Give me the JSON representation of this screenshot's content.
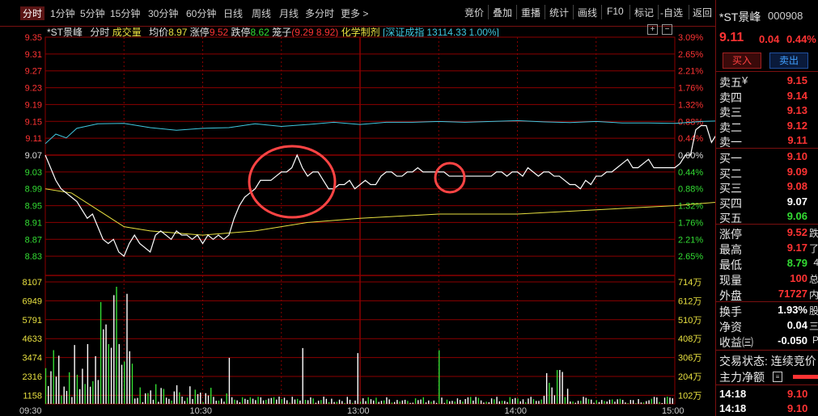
{
  "tabs": [
    "分时",
    "1分钟",
    "5分钟",
    "15分钟",
    "30分钟",
    "60分钟",
    "日线",
    "周线",
    "月线",
    "多分时",
    "更多 >"
  ],
  "right_buttons": [
    "竞价",
    "叠加",
    "重播",
    "统计",
    "画线",
    "F10",
    "标记",
    "-自选",
    "返回"
  ],
  "info": {
    "name": "*ST景峰",
    "period": "分时",
    "volume_label": "成交量",
    "avg_label": "均价",
    "avg": "8.97",
    "limit_up_label": "涨停",
    "limit_up": "9.52",
    "limit_down_label": "跌停",
    "limit_down": "8.62",
    "cage_label": "笼子",
    "cage": "(9.29 8.92)",
    "sector": "化学制剂",
    "index_name": "[深证成指",
    "index_val": "13114.33",
    "index_pct": "1.00%]"
  },
  "colors": {
    "price": "#ffffff",
    "avg": "#e8e040",
    "index": "#40c8e0",
    "up": "#ff3333",
    "down": "#33dd33",
    "grid": "#8b0000",
    "annotation": "#ff4444"
  },
  "chart_data": {
    "type": "line",
    "title": "",
    "price_axis": [
      "9.35",
      "9.31",
      "9.27",
      "9.23",
      "9.19",
      "9.15",
      "9.11",
      "9.07",
      "9.03",
      "8.99",
      "8.95",
      "8.91",
      "8.87",
      "8.83"
    ],
    "pct_axis": [
      "3.09%",
      "2.65%",
      "2.21%",
      "1.76%",
      "1.32%",
      "0.88%",
      "0.44%",
      "0.00%",
      "0.44%",
      "0.88%",
      "1.32%",
      "1.76%",
      "2.21%",
      "2.65%"
    ],
    "volume_axis_left": [
      "8107",
      "6949",
      "5791",
      "4633",
      "3474",
      "2316",
      "1158"
    ],
    "volume_axis_right": [
      "714万",
      "612万",
      "510万",
      "408万",
      "306万",
      "204万",
      "102万"
    ],
    "time_labels": [
      "09:30",
      "10:30",
      "13:00",
      "14:00",
      "15:00"
    ],
    "ylim": [
      8.79,
      9.35
    ],
    "prev_close": 9.07,
    "price": [
      [
        0,
        9.07
      ],
      [
        2,
        9.04
      ],
      [
        4,
        9.01
      ],
      [
        6,
        8.99
      ],
      [
        8,
        8.98
      ],
      [
        10,
        8.97
      ],
      [
        12,
        8.96
      ],
      [
        14,
        8.94
      ],
      [
        16,
        8.92
      ],
      [
        18,
        8.93
      ],
      [
        20,
        8.9
      ],
      [
        22,
        8.87
      ],
      [
        24,
        8.86
      ],
      [
        26,
        8.87
      ],
      [
        28,
        8.84
      ],
      [
        30,
        8.83
      ],
      [
        32,
        8.86
      ],
      [
        34,
        8.88
      ],
      [
        36,
        8.86
      ],
      [
        38,
        8.85
      ],
      [
        40,
        8.84
      ],
      [
        42,
        8.88
      ],
      [
        44,
        8.89
      ],
      [
        46,
        8.88
      ],
      [
        48,
        8.87
      ],
      [
        50,
        8.89
      ],
      [
        52,
        8.88
      ],
      [
        54,
        8.88
      ],
      [
        56,
        8.87
      ],
      [
        58,
        8.88
      ],
      [
        60,
        8.86
      ],
      [
        62,
        8.88
      ],
      [
        64,
        8.87
      ],
      [
        66,
        8.88
      ],
      [
        68,
        8.87
      ],
      [
        70,
        8.88
      ],
      [
        72,
        8.92
      ],
      [
        74,
        8.95
      ],
      [
        76,
        8.97
      ],
      [
        78,
        8.98
      ],
      [
        80,
        8.99
      ],
      [
        82,
        9.01
      ],
      [
        84,
        9.01
      ],
      [
        86,
        9.01
      ],
      [
        88,
        9.02
      ],
      [
        90,
        9.03
      ],
      [
        92,
        9.03
      ],
      [
        94,
        9.04
      ],
      [
        96,
        9.07
      ],
      [
        98,
        9.04
      ],
      [
        100,
        9.02
      ],
      [
        102,
        9.03
      ],
      [
        104,
        9.03
      ],
      [
        106,
        9.01
      ],
      [
        108,
        8.99
      ],
      [
        110,
        8.99
      ],
      [
        112,
        9.0
      ],
      [
        114,
        9.0
      ],
      [
        116,
        9.01
      ],
      [
        118,
        8.99
      ],
      [
        120,
        9.0
      ],
      [
        122,
        9.01
      ],
      [
        124,
        9.0
      ],
      [
        126,
        9.0
      ],
      [
        128,
        9.02
      ],
      [
        130,
        9.03
      ],
      [
        132,
        9.03
      ],
      [
        134,
        9.02
      ],
      [
        136,
        9.02
      ],
      [
        138,
        9.03
      ],
      [
        140,
        9.03
      ],
      [
        142,
        9.04
      ],
      [
        144,
        9.03
      ],
      [
        146,
        9.03
      ],
      [
        148,
        9.03
      ],
      [
        150,
        9.03
      ],
      [
        152,
        9.03
      ],
      [
        154,
        9.02
      ],
      [
        156,
        9.02
      ],
      [
        158,
        9.02
      ],
      [
        160,
        9.02
      ],
      [
        162,
        9.02
      ],
      [
        164,
        9.02
      ],
      [
        166,
        9.02
      ],
      [
        168,
        9.02
      ],
      [
        170,
        9.02
      ],
      [
        172,
        9.03
      ],
      [
        174,
        9.03
      ],
      [
        176,
        9.02
      ],
      [
        178,
        9.03
      ],
      [
        180,
        9.03
      ],
      [
        182,
        9.02
      ],
      [
        184,
        9.04
      ],
      [
        186,
        9.03
      ],
      [
        188,
        9.02
      ],
      [
        190,
        9.03
      ],
      [
        192,
        9.03
      ],
      [
        194,
        9.02
      ],
      [
        196,
        9.02
      ],
      [
        198,
        9.01
      ],
      [
        200,
        9.0
      ],
      [
        202,
        9.0
      ],
      [
        204,
        8.99
      ],
      [
        206,
        9.01
      ],
      [
        208,
        9.0
      ],
      [
        210,
        9.02
      ],
      [
        212,
        9.02
      ],
      [
        214,
        9.03
      ],
      [
        216,
        9.03
      ],
      [
        218,
        9.04
      ],
      [
        220,
        9.05
      ],
      [
        222,
        9.06
      ],
      [
        224,
        9.04
      ],
      [
        226,
        9.04
      ],
      [
        228,
        9.05
      ],
      [
        230,
        9.06
      ],
      [
        232,
        9.04
      ],
      [
        234,
        9.04
      ],
      [
        236,
        9.04
      ],
      [
        238,
        9.04
      ],
      [
        240,
        9.04
      ],
      [
        242,
        9.05
      ],
      [
        244,
        9.07
      ],
      [
        246,
        9.07
      ],
      [
        248,
        9.13
      ],
      [
        250,
        9.14
      ],
      [
        252,
        9.14
      ],
      [
        254,
        9.1
      ],
      [
        256,
        9.12
      ],
      [
        258,
        9.14
      ],
      [
        260,
        9.15
      ],
      [
        262,
        9.15
      ],
      [
        264,
        9.15
      ],
      [
        266,
        9.16
      ],
      [
        268,
        9.16
      ],
      [
        270,
        9.15
      ],
      [
        272,
        9.13
      ],
      [
        274,
        9.13
      ],
      [
        276,
        9.11
      ],
      [
        278,
        9.1
      ],
      [
        280,
        9.1
      ],
      [
        282,
        9.1
      ],
      [
        284,
        9.1
      ],
      [
        286,
        9.09
      ],
      [
        288,
        9.09
      ],
      [
        290,
        9.1
      ],
      [
        292,
        9.1
      ],
      [
        294,
        9.1
      ],
      [
        296,
        9.11
      ],
      [
        298,
        9.11
      ]
    ],
    "avg": [
      [
        0,
        8.99
      ],
      [
        10,
        8.98
      ],
      [
        20,
        8.94
      ],
      [
        30,
        8.9
      ],
      [
        40,
        8.89
      ],
      [
        60,
        8.88
      ],
      [
        80,
        8.89
      ],
      [
        100,
        8.91
      ],
      [
        120,
        8.92
      ],
      [
        150,
        8.93
      ],
      [
        180,
        8.93
      ],
      [
        210,
        8.94
      ],
      [
        240,
        8.95
      ],
      [
        260,
        8.96
      ],
      [
        280,
        8.97
      ],
      [
        298,
        8.97
      ]
    ],
    "index_pct": [
      [
        0,
        0.3
      ],
      [
        4,
        0.55
      ],
      [
        8,
        0.45
      ],
      [
        12,
        0.7
      ],
      [
        20,
        0.82
      ],
      [
        30,
        0.83
      ],
      [
        40,
        0.72
      ],
      [
        50,
        0.65
      ],
      [
        60,
        0.7
      ],
      [
        70,
        0.72
      ],
      [
        80,
        0.82
      ],
      [
        90,
        0.75
      ],
      [
        100,
        0.8
      ],
      [
        110,
        0.86
      ],
      [
        120,
        0.8
      ],
      [
        130,
        0.86
      ],
      [
        140,
        0.86
      ],
      [
        150,
        0.88
      ],
      [
        160,
        0.86
      ],
      [
        170,
        0.88
      ],
      [
        180,
        0.9
      ],
      [
        190,
        0.87
      ],
      [
        200,
        0.85
      ],
      [
        210,
        0.88
      ],
      [
        220,
        0.84
      ],
      [
        230,
        0.84
      ],
      [
        240,
        0.83
      ],
      [
        250,
        0.88
      ],
      [
        260,
        0.9
      ],
      [
        270,
        0.92
      ],
      [
        280,
        0.94
      ],
      [
        290,
        0.95
      ],
      [
        298,
        0.93
      ]
    ]
  },
  "panel": {
    "name": "*ST景峰",
    "code": "000908",
    "price": "9.11",
    "change": "0.04",
    "change_pct": "0.44%",
    "buy_btn": "买入",
    "sell_btn": "卖出",
    "asks": [
      {
        "label": "卖五",
        "price": "9.15"
      },
      {
        "label": "卖四",
        "price": "9.14"
      },
      {
        "label": "卖三",
        "price": "9.13"
      },
      {
        "label": "卖二",
        "price": "9.12"
      },
      {
        "label": "卖一",
        "price": "9.11"
      }
    ],
    "ask_suffix": "¥",
    "bids": [
      {
        "label": "买一",
        "price": "9.10"
      },
      {
        "label": "买二",
        "price": "9.09"
      },
      {
        "label": "买三",
        "price": "9.08"
      },
      {
        "label": "买四",
        "price": "9.07"
      },
      {
        "label": "买五",
        "price": "9.06"
      }
    ],
    "stats": [
      {
        "label": "涨停",
        "value": "9.52",
        "extra": "跌"
      },
      {
        "label": "最高",
        "value": "9.17",
        "extra": "了"
      },
      {
        "label": "最低",
        "value": "8.79",
        "extra": "4"
      },
      {
        "label": "现量",
        "value": "100",
        "extra": "总"
      },
      {
        "label": "外盘",
        "value": "71727",
        "extra": "内"
      }
    ],
    "stats2": [
      {
        "label": "换手",
        "value": "1.93%",
        "extra": "股"
      },
      {
        "label": "净资",
        "value": "0.04",
        "extra": "三"
      },
      {
        "label": "收益㈢",
        "value": "-0.050",
        "extra": "P"
      }
    ],
    "trade_status": "交易状态: 连续竞价",
    "main_net": "主力净额",
    "ticks": [
      {
        "time": "14:18",
        "price": "9.10"
      },
      {
        "time": "14:18",
        "price": "9.10"
      }
    ]
  }
}
